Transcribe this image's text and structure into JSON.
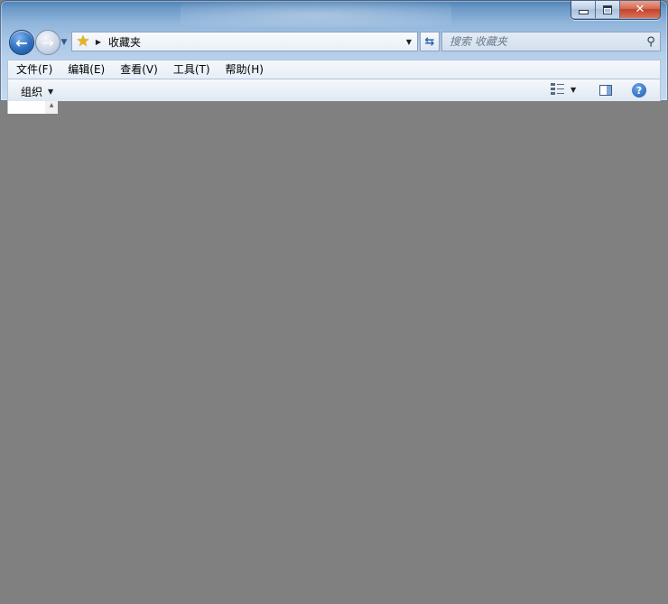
{
  "window": {
    "caption_buttons": {
      "minimize": "",
      "maximize": "",
      "close": "✕"
    }
  },
  "navigation": {
    "back_icon": "arrow-left-icon",
    "forward_icon": "arrow-right-icon",
    "address": {
      "icon": "star-icon",
      "crumb": "收藏夹"
    },
    "refresh_icon": "refresh-icon",
    "search_placeholder": "搜索 收藏夹"
  },
  "menu": {
    "items": [
      {
        "label": "文件(F)"
      },
      {
        "label": "编辑(E)"
      },
      {
        "label": "查看(V)"
      },
      {
        "label": "工具(T)"
      },
      {
        "label": "帮助(H)"
      }
    ]
  },
  "command_bar": {
    "organize_label": "组织",
    "help_label": "?"
  },
  "colors": {
    "frame": "#a9c6e6",
    "overlay": "#808080"
  }
}
